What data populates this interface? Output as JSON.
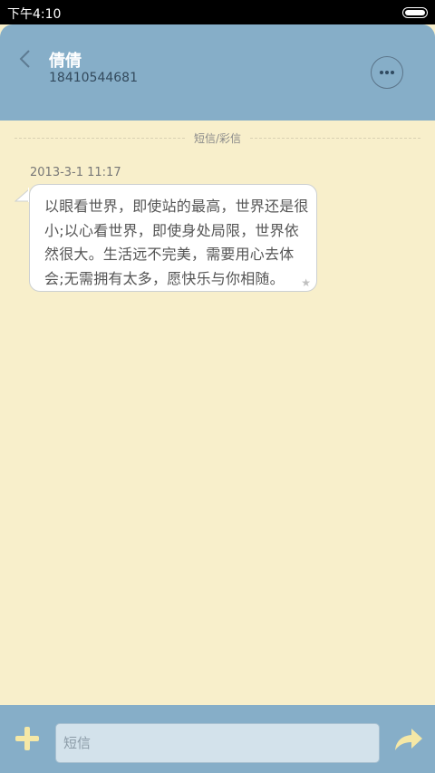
{
  "status_bar": {
    "time": "下午4:10"
  },
  "header": {
    "contact_name": "倩倩",
    "contact_number": "18410544681"
  },
  "thread": {
    "type_label": "短信/彩信",
    "messages": [
      {
        "timestamp": "2013-3-1 11:17",
        "text": "以眼看世界，即使站的最高，世界还是很小;以心看世界，即使身处局限，世界依然很大。生活远不完美，需要用心去体会;无需拥有太多，愿快乐与你相随。",
        "starred": false
      }
    ]
  },
  "composer": {
    "placeholder": "短信"
  },
  "icons": {
    "back": "chevron-left-icon",
    "more": "more-dots-icon",
    "add": "plus-icon",
    "send": "send-arrow-icon",
    "star": "star-icon",
    "battery": "battery-icon"
  },
  "colors": {
    "header_bg": "#86aec8",
    "thread_bg": "#f8efcb",
    "accent_yellow": "#f5e8a6"
  }
}
